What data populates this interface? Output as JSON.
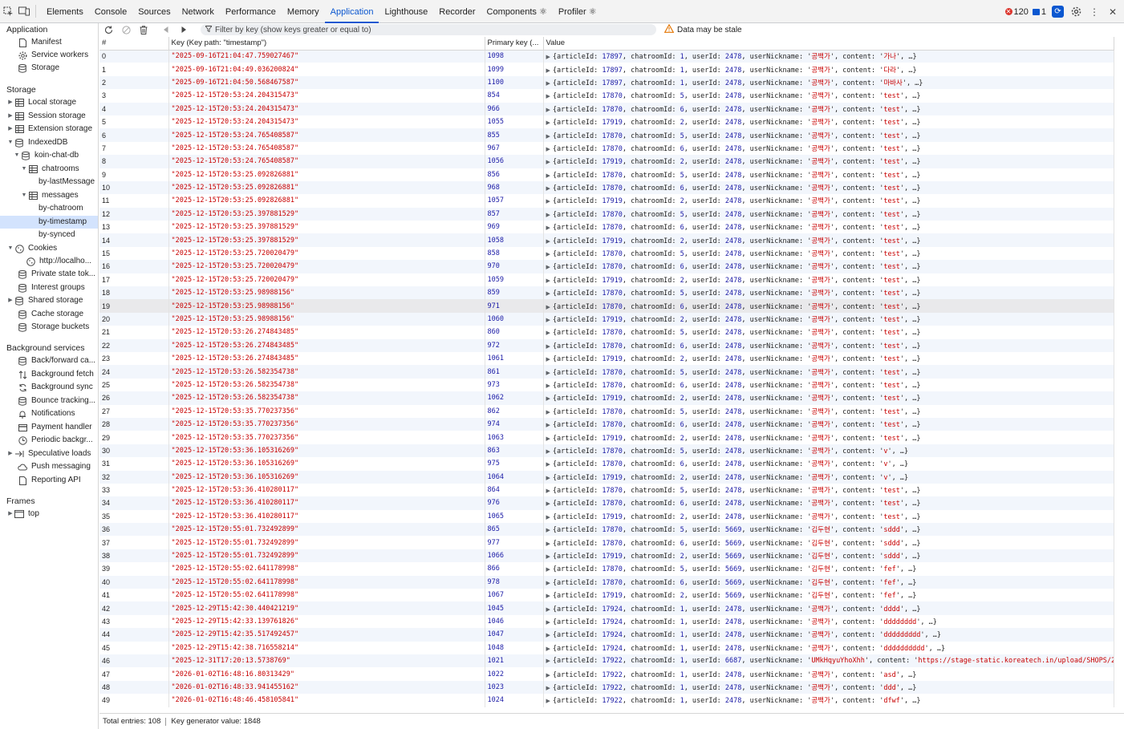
{
  "tabs": [
    "Elements",
    "Console",
    "Sources",
    "Network",
    "Performance",
    "Memory",
    "Application",
    "Lighthouse",
    "Recorder",
    "Components ⚛",
    "Profiler ⚛"
  ],
  "active_tab": "Application",
  "status": {
    "errors": "120",
    "messages": "1"
  },
  "sidebar": {
    "sections": {
      "application": "Application",
      "storage": "Storage",
      "background": "Background services",
      "frames": "Frames"
    },
    "application_items": [
      "Manifest",
      "Service workers",
      "Storage"
    ],
    "storage_items": {
      "local": "Local storage",
      "session": "Session storage",
      "extension": "Extension storage",
      "indexeddb": "IndexedDB",
      "db": "koin-chat-db",
      "chatrooms": "chatrooms",
      "by_last": "by-lastMessage",
      "messages": "messages",
      "by_chatroom": "by-chatroom",
      "by_timestamp": "by-timestamp",
      "by_synced": "by-synced",
      "cookies": "Cookies",
      "cookie_host": "http://localho...",
      "private_state": "Private state tok...",
      "interest": "Interest groups",
      "shared": "Shared storage",
      "cache": "Cache storage",
      "buckets": "Storage buckets"
    },
    "background_items": [
      "Back/forward ca...",
      "Background fetch",
      "Background sync",
      "Bounce tracking...",
      "Notifications",
      "Payment handler",
      "Periodic backgr...",
      "Speculative loads",
      "Push messaging",
      "Reporting API"
    ],
    "frames_items": [
      "top"
    ]
  },
  "toolbar": {
    "filter_placeholder": "Filter by key (show keys greater or equal to)",
    "stale_text": "Data may be stale"
  },
  "table": {
    "headers": [
      "#",
      "Key (Key path: \"timestamp\")",
      "Primary key (...",
      "Value"
    ],
    "rows": [
      [
        "0",
        "\"2025-09-16T21:04:47.759027467\"",
        "1098",
        17897,
        1,
        2478,
        "공백가",
        "가나"
      ],
      [
        "1",
        "\"2025-09-16T21:04:49.036200824\"",
        "1099",
        17897,
        1,
        2478,
        "공백가",
        "다라"
      ],
      [
        "2",
        "\"2025-09-16T21:04:50.568467587\"",
        "1100",
        17897,
        1,
        2478,
        "공백가",
        "마바사"
      ],
      [
        "3",
        "\"2025-12-15T20:53:24.204315473\"",
        "854",
        17870,
        5,
        2478,
        "공백가",
        "test"
      ],
      [
        "4",
        "\"2025-12-15T20:53:24.204315473\"",
        "966",
        17870,
        6,
        2478,
        "공백가",
        "test"
      ],
      [
        "5",
        "\"2025-12-15T20:53:24.204315473\"",
        "1055",
        17919,
        2,
        2478,
        "공백가",
        "test"
      ],
      [
        "6",
        "\"2025-12-15T20:53:24.765408587\"",
        "855",
        17870,
        5,
        2478,
        "공백가",
        "test"
      ],
      [
        "7",
        "\"2025-12-15T20:53:24.765408587\"",
        "967",
        17870,
        6,
        2478,
        "공백가",
        "test"
      ],
      [
        "8",
        "\"2025-12-15T20:53:24.765408587\"",
        "1056",
        17919,
        2,
        2478,
        "공백가",
        "test"
      ],
      [
        "9",
        "\"2025-12-15T20:53:25.092826881\"",
        "856",
        17870,
        5,
        2478,
        "공백가",
        "test"
      ],
      [
        "10",
        "\"2025-12-15T20:53:25.092826881\"",
        "968",
        17870,
        6,
        2478,
        "공백가",
        "test"
      ],
      [
        "11",
        "\"2025-12-15T20:53:25.092826881\"",
        "1057",
        17919,
        2,
        2478,
        "공백가",
        "test"
      ],
      [
        "12",
        "\"2025-12-15T20:53:25.397881529\"",
        "857",
        17870,
        5,
        2478,
        "공백가",
        "test"
      ],
      [
        "13",
        "\"2025-12-15T20:53:25.397881529\"",
        "969",
        17870,
        6,
        2478,
        "공백가",
        "test"
      ],
      [
        "14",
        "\"2025-12-15T20:53:25.397881529\"",
        "1058",
        17919,
        2,
        2478,
        "공백가",
        "test"
      ],
      [
        "15",
        "\"2025-12-15T20:53:25.720020479\"",
        "858",
        17870,
        5,
        2478,
        "공백가",
        "test"
      ],
      [
        "16",
        "\"2025-12-15T20:53:25.720020479\"",
        "970",
        17870,
        6,
        2478,
        "공백가",
        "test"
      ],
      [
        "17",
        "\"2025-12-15T20:53:25.720020479\"",
        "1059",
        17919,
        2,
        2478,
        "공백가",
        "test"
      ],
      [
        "18",
        "\"2025-12-15T20:53:25.98988156\"",
        "859",
        17870,
        5,
        2478,
        "공백가",
        "test"
      ],
      [
        "19",
        "\"2025-12-15T20:53:25.98988156\"",
        "971",
        17870,
        6,
        2478,
        "공백가",
        "test"
      ],
      [
        "20",
        "\"2025-12-15T20:53:25.98988156\"",
        "1060",
        17919,
        2,
        2478,
        "공백가",
        "test"
      ],
      [
        "21",
        "\"2025-12-15T20:53:26.274843485\"",
        "860",
        17870,
        5,
        2478,
        "공백가",
        "test"
      ],
      [
        "22",
        "\"2025-12-15T20:53:26.274843485\"",
        "972",
        17870,
        6,
        2478,
        "공백가",
        "test"
      ],
      [
        "23",
        "\"2025-12-15T20:53:26.274843485\"",
        "1061",
        17919,
        2,
        2478,
        "공백가",
        "test"
      ],
      [
        "24",
        "\"2025-12-15T20:53:26.582354738\"",
        "861",
        17870,
        5,
        2478,
        "공백가",
        "test"
      ],
      [
        "25",
        "\"2025-12-15T20:53:26.582354738\"",
        "973",
        17870,
        6,
        2478,
        "공백가",
        "test"
      ],
      [
        "26",
        "\"2025-12-15T20:53:26.582354738\"",
        "1062",
        17919,
        2,
        2478,
        "공백가",
        "test"
      ],
      [
        "27",
        "\"2025-12-15T20:53:35.770237356\"",
        "862",
        17870,
        5,
        2478,
        "공백가",
        "test"
      ],
      [
        "28",
        "\"2025-12-15T20:53:35.770237356\"",
        "974",
        17870,
        6,
        2478,
        "공백가",
        "test"
      ],
      [
        "29",
        "\"2025-12-15T20:53:35.770237356\"",
        "1063",
        17919,
        2,
        2478,
        "공백가",
        "test"
      ],
      [
        "30",
        "\"2025-12-15T20:53:36.105316269\"",
        "863",
        17870,
        5,
        2478,
        "공백가",
        "v"
      ],
      [
        "31",
        "\"2025-12-15T20:53:36.105316269\"",
        "975",
        17870,
        6,
        2478,
        "공백가",
        "v"
      ],
      [
        "32",
        "\"2025-12-15T20:53:36.105316269\"",
        "1064",
        17919,
        2,
        2478,
        "공백가",
        "v"
      ],
      [
        "33",
        "\"2025-12-15T20:53:36.410280117\"",
        "864",
        17870,
        5,
        2478,
        "공백가",
        "test"
      ],
      [
        "34",
        "\"2025-12-15T20:53:36.410280117\"",
        "976",
        17870,
        6,
        2478,
        "공백가",
        "test"
      ],
      [
        "35",
        "\"2025-12-15T20:53:36.410280117\"",
        "1065",
        17919,
        2,
        2478,
        "공백가",
        "test"
      ],
      [
        "36",
        "\"2025-12-15T20:55:01.732492899\"",
        "865",
        17870,
        5,
        5669,
        "김두현",
        "sddd"
      ],
      [
        "37",
        "\"2025-12-15T20:55:01.732492899\"",
        "977",
        17870,
        6,
        5669,
        "김두현",
        "sddd"
      ],
      [
        "38",
        "\"2025-12-15T20:55:01.732492899\"",
        "1066",
        17919,
        2,
        5669,
        "김두현",
        "sddd"
      ],
      [
        "39",
        "\"2025-12-15T20:55:02.641178998\"",
        "866",
        17870,
        5,
        5669,
        "김두현",
        "fef"
      ],
      [
        "40",
        "\"2025-12-15T20:55:02.641178998\"",
        "978",
        17870,
        6,
        5669,
        "김두현",
        "fef"
      ],
      [
        "41",
        "\"2025-12-15T20:55:02.641178998\"",
        "1067",
        17919,
        2,
        5669,
        "김두현",
        "fef"
      ],
      [
        "42",
        "\"2025-12-29T15:42:30.440421219\"",
        "1045",
        17924,
        1,
        2478,
        "공백가",
        "dddd"
      ],
      [
        "43",
        "\"2025-12-29T15:42:33.139761826\"",
        "1046",
        17924,
        1,
        2478,
        "공백가",
        "dddddddd"
      ],
      [
        "44",
        "\"2025-12-29T15:42:35.517492457\"",
        "1047",
        17924,
        1,
        2478,
        "공백가",
        "ddddddddd"
      ],
      [
        "45",
        "\"2025-12-29T15:42:38.716558214\"",
        "1048",
        17924,
        1,
        2478,
        "공백가",
        "dddddddddd"
      ],
      [
        "46",
        "\"2025-12-31T17:20:13.5738769\"",
        "1021",
        17922,
        1,
        6687,
        "UMkHqyuYhoXhh",
        "https://stage-static.koreatech.in/upload/SHOPS/202..."
      ],
      [
        "47",
        "\"2026-01-02T16:48:16.80313429\"",
        "1022",
        17922,
        1,
        2478,
        "공백가",
        "asd"
      ],
      [
        "48",
        "\"2026-01-02T16:48:33.941455162\"",
        "1023",
        17922,
        1,
        2478,
        "공백가",
        "ddd"
      ],
      [
        "49",
        "\"2026-01-02T16:48:46.458105841\"",
        "1024",
        17922,
        1,
        2478,
        "공백가",
        "dfwf"
      ]
    ],
    "highlighted_row": "19"
  },
  "footer": {
    "total": "Total entries: 108",
    "keygen": "Key generator value: 1848"
  }
}
